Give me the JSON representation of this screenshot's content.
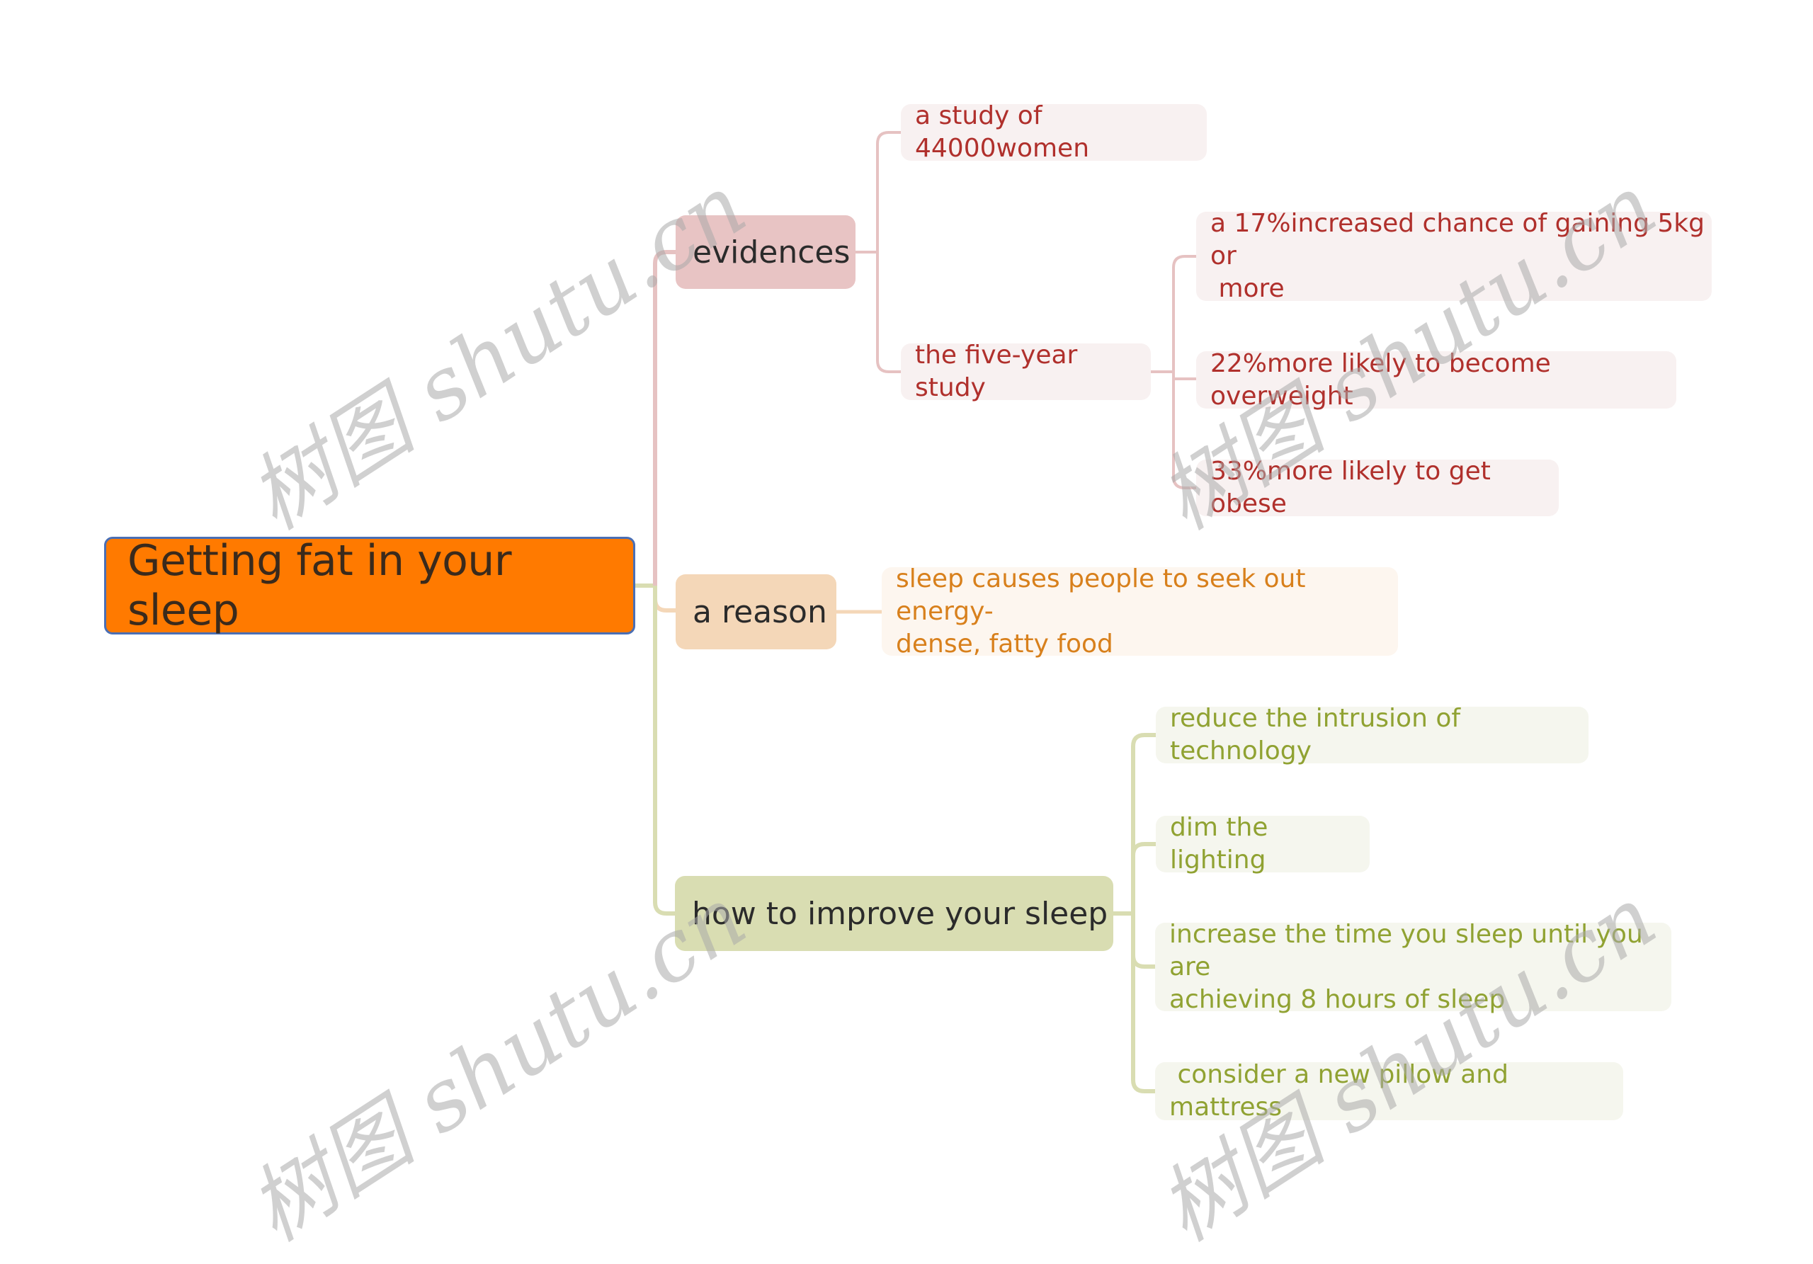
{
  "root": {
    "label": "Getting fat in your sleep"
  },
  "branches": [
    {
      "label": "evidences",
      "children": [
        {
          "label": "a study of 44000women"
        },
        {
          "label": "the five-year study",
          "children": [
            {
              "label": "a 17%increased chance of gaining 5kg or\n more"
            },
            {
              "label": "22%more likely to become overweight"
            },
            {
              "label": "33%more likely to get obese"
            }
          ]
        }
      ]
    },
    {
      "label": "a reason",
      "children": [
        {
          "label": "sleep causes people to seek out energy-\ndense, fatty food"
        }
      ]
    },
    {
      "label": "how to improve your sleep",
      "children": [
        {
          "label": "reduce the intrusion of technology"
        },
        {
          "label": "dim the lighting"
        },
        {
          "label": "increase the time you sleep until you are\nachieving 8 hours of sleep"
        },
        {
          "label": " consider a new pillow and mattress"
        }
      ]
    }
  ],
  "colors": {
    "root_fill": "#ff7a00",
    "root_border": "#4a6fb5",
    "evidences": "#e8c4c4",
    "reason": "#f4d7b8",
    "improve": "#d9ddb2",
    "evidences_text": "#b0302c",
    "reason_text": "#d8801c",
    "improve_text": "#90a232"
  },
  "watermark": {
    "text": "树图 shutu.cn"
  }
}
